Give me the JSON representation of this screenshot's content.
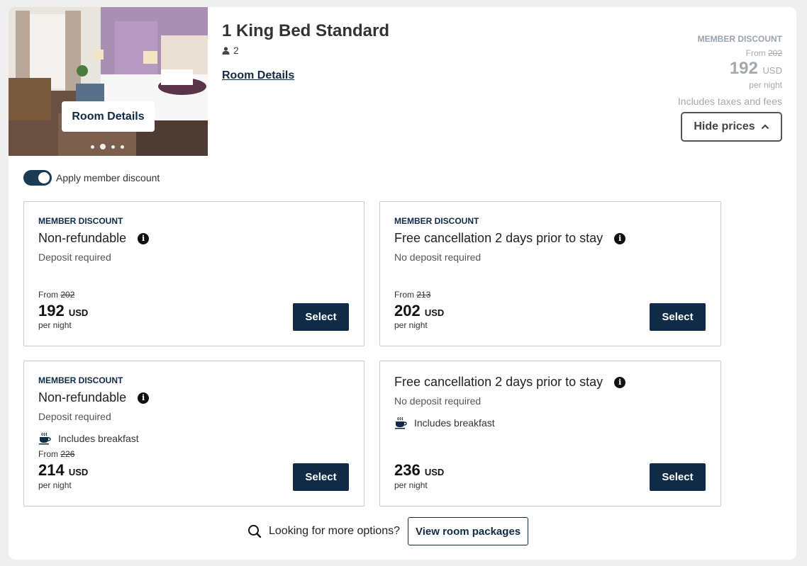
{
  "room": {
    "title": "1 King Bed Standard",
    "guests": "2",
    "details_link": "Room Details",
    "photo_button": "Room Details"
  },
  "summary_price": {
    "badge": "MEMBER DISCOUNT",
    "from_label": "From",
    "original": "202",
    "amount": "192",
    "currency": "USD",
    "per_night": "per night",
    "taxes_note": "Includes taxes and fees",
    "hide_button": "Hide prices"
  },
  "toggle": {
    "label": "Apply member discount",
    "on": true
  },
  "rates": [
    {
      "badge": "MEMBER DISCOUNT",
      "name": "Non-refundable",
      "sub": "Deposit required",
      "breakfast": "",
      "from_label": "From",
      "original": "202",
      "amount": "192",
      "currency": "USD",
      "per_night": "per night",
      "button": "Select"
    },
    {
      "badge": "MEMBER DISCOUNT",
      "name": "Free cancellation 2 days prior to stay",
      "sub": "No deposit required",
      "breakfast": "",
      "from_label": "From",
      "original": "213",
      "amount": "202",
      "currency": "USD",
      "per_night": "per night",
      "button": "Select"
    },
    {
      "badge": "MEMBER DISCOUNT",
      "name": "Non-refundable",
      "sub": "Deposit required",
      "breakfast": "Includes breakfast",
      "from_label": "From",
      "original": "226",
      "amount": "214",
      "currency": "USD",
      "per_night": "per night",
      "button": "Select"
    },
    {
      "badge": "",
      "name": "Free cancellation 2 days prior to stay",
      "sub": "No deposit required",
      "breakfast": "Includes breakfast",
      "from_label": "",
      "original": "",
      "amount": "236",
      "currency": "USD",
      "per_night": "per night",
      "button": "Select"
    }
  ],
  "more_options": {
    "text": "Looking for more options?",
    "button": "View room packages"
  },
  "colors": {
    "primary": "#0f2b46",
    "toggle": "#1b3a55",
    "muted": "#a4a9b0"
  },
  "icons": [
    "person-icon",
    "info-icon",
    "coffee-icon",
    "search-icon",
    "chevron-up-icon"
  ],
  "carousel": {
    "count": 4,
    "active": 2
  }
}
